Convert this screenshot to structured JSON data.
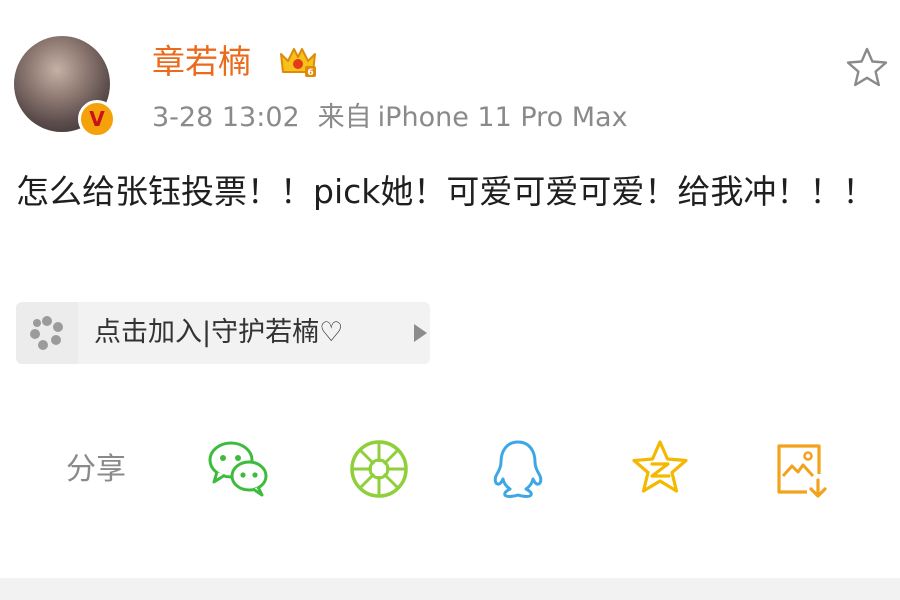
{
  "post": {
    "author": {
      "name": "章若楠",
      "verified_badge": "V",
      "member_icon": "crown-member-icon"
    },
    "time": "3-28 13:02",
    "source_prefix": "来自",
    "source_device": "iPhone 11 Pro Max",
    "text": "怎么给张钰投票！！pick她！可爱可爱可爱！给我冲！！！",
    "favorite_icon": "star-outline-icon"
  },
  "topic_card": {
    "label": "点击加入|守护若楠♡",
    "icon": "flower-icon"
  },
  "share": {
    "label": "分享",
    "targets": [
      {
        "name": "wechat-icon",
        "color": "#3dbb3d"
      },
      {
        "name": "moments-icon",
        "color": "#8ecf3a"
      },
      {
        "name": "qq-icon",
        "color": "#3da7e6"
      },
      {
        "name": "qzone-icon",
        "color": "#f5b800"
      },
      {
        "name": "save-image-icon",
        "color": "#f2a21b"
      }
    ]
  },
  "colors": {
    "accent_orange": "#ea6b1c",
    "muted_text": "#8a8a8a",
    "body_text": "#1f1f1f"
  }
}
